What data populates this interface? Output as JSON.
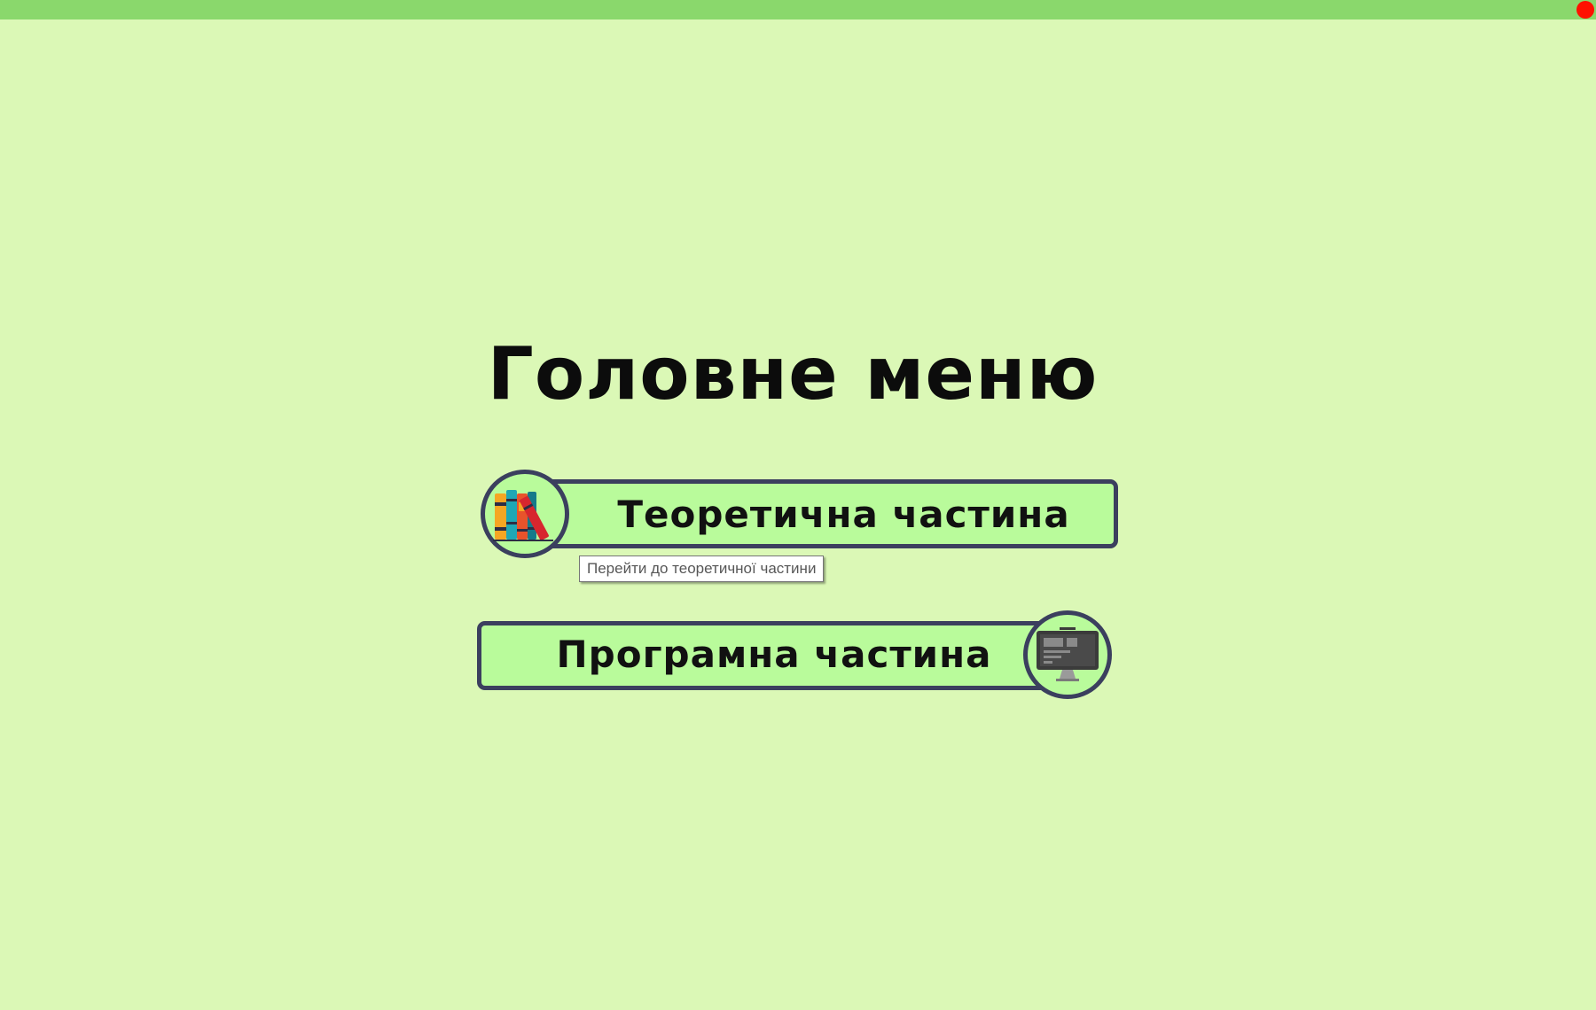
{
  "window": {
    "close_color": "#ff1100",
    "titlebar_color": "#8ad86c",
    "background_color": "#dbf8b6"
  },
  "main": {
    "title": "Головне меню",
    "buttons": [
      {
        "label": "Теоретична частина",
        "icon": "books-icon",
        "tooltip": "Перейти до теоретичної частини"
      },
      {
        "label": "Програмна частина",
        "icon": "computer-monitor-icon"
      }
    ]
  },
  "colors": {
    "button_fill": "#b9fb9b",
    "button_border": "#3b3f5e"
  }
}
